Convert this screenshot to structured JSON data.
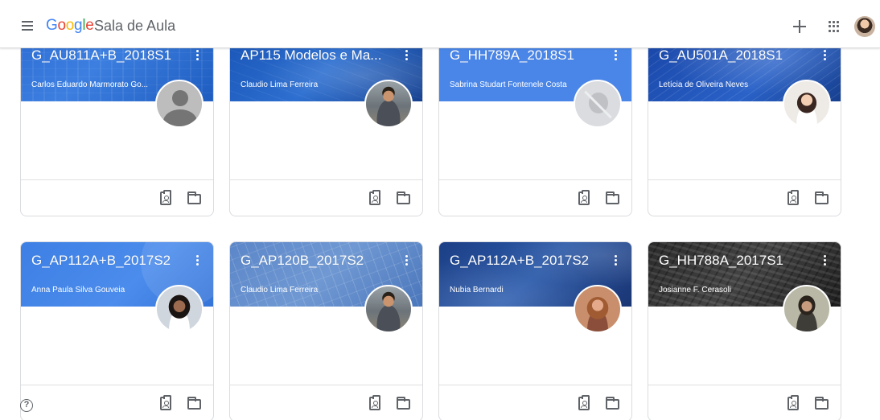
{
  "header": {
    "logo_letters": [
      "G",
      "o",
      "o",
      "g",
      "l",
      "e"
    ],
    "product_name": "Sala de Aula",
    "create_icon": "plus-icon",
    "apps_icon": "apps-grid-icon",
    "account_icon": "account-avatar"
  },
  "classes": [
    {
      "title": "G_AU811A+B_2018S1",
      "owner": "Carlos Eduardo Marmorato Go...",
      "avatar": "default-person"
    },
    {
      "title": "AP115 Modelos e Ma...",
      "owner": "Claudio Lima Ferreira",
      "avatar": "photo-man"
    },
    {
      "title": "G_HH789A_2018S1",
      "owner": "Sabrina Studart Fontenele Costa",
      "avatar": "no-photo"
    },
    {
      "title": "G_AU501A_2018S1",
      "owner": "Letícia de Oliveira Neves",
      "avatar": "photo-woman"
    },
    {
      "title": "G_AP112A+B_2017S2",
      "owner": "Anna Paula Silva Gouveia",
      "avatar": "photo-woman"
    },
    {
      "title": "G_AP120B_2017S2",
      "owner": "Claudio Lima Ferreira",
      "avatar": "photo-man"
    },
    {
      "title": "G_AP112A+B_2017S2",
      "owner": "Nubia Bernardi",
      "avatar": "photo-woman"
    },
    {
      "title": "G_HH788A_2017S1",
      "owner": "Josianne F. Cerasoli",
      "avatar": "photo-woman"
    }
  ],
  "card_icons": {
    "more": "more-vert-icon",
    "assignments": "assignment-ind-icon",
    "drive_folder": "folder-icon"
  },
  "help": {
    "symbol": "?"
  }
}
